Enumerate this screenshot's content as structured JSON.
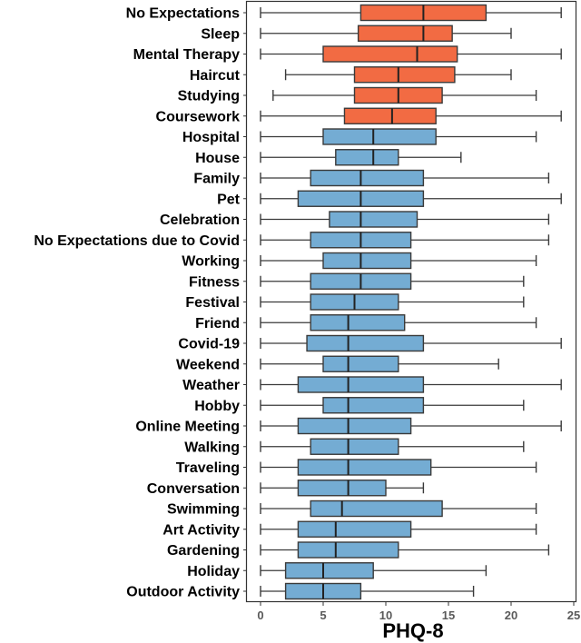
{
  "chart_data": {
    "type": "boxplot",
    "orientation": "horizontal",
    "title": "",
    "xlabel": "PHQ-8",
    "ylabel": "",
    "xlim": [
      0,
      25
    ],
    "xticks": [
      0,
      5,
      10,
      15,
      20,
      25
    ],
    "grid": false,
    "legend": "none",
    "colors": {
      "highlight": "#f26b43",
      "normal": "#74acd3",
      "stroke": "#3a3a3a"
    },
    "categories": [
      {
        "label": "No Expectations",
        "min": 0,
        "q1": 8,
        "median": 13,
        "q3": 18,
        "max": 24,
        "group": "highlight"
      },
      {
        "label": "Sleep",
        "min": 0,
        "q1": 7.8,
        "median": 13,
        "q3": 15.3,
        "max": 20,
        "group": "highlight"
      },
      {
        "label": "Mental Therapy",
        "min": 0,
        "q1": 5,
        "median": 12.5,
        "q3": 15.7,
        "max": 24,
        "group": "highlight"
      },
      {
        "label": "Haircut",
        "min": 2,
        "q1": 7.5,
        "median": 11,
        "q3": 15.5,
        "max": 20,
        "group": "highlight"
      },
      {
        "label": "Studying",
        "min": 1,
        "q1": 7.5,
        "median": 11,
        "q3": 14.5,
        "max": 22,
        "group": "highlight"
      },
      {
        "label": "Coursework",
        "min": 0,
        "q1": 6.7,
        "median": 10.5,
        "q3": 14,
        "max": 24,
        "group": "highlight"
      },
      {
        "label": "Hospital",
        "min": 0,
        "q1": 5,
        "median": 9,
        "q3": 14,
        "max": 22,
        "group": "normal"
      },
      {
        "label": "House",
        "min": 0,
        "q1": 6,
        "median": 9,
        "q3": 11,
        "max": 16,
        "group": "normal"
      },
      {
        "label": "Family",
        "min": 0,
        "q1": 4,
        "median": 8,
        "q3": 13,
        "max": 23,
        "group": "normal"
      },
      {
        "label": "Pet",
        "min": 0,
        "q1": 3,
        "median": 8,
        "q3": 13,
        "max": 24,
        "group": "normal"
      },
      {
        "label": "Celebration",
        "min": 0,
        "q1": 5.5,
        "median": 8,
        "q3": 12.5,
        "max": 23,
        "group": "normal"
      },
      {
        "label": "No Expectations due to Covid",
        "min": 0,
        "q1": 4,
        "median": 8,
        "q3": 12,
        "max": 23,
        "group": "normal"
      },
      {
        "label": "Working",
        "min": 0,
        "q1": 5,
        "median": 8,
        "q3": 12,
        "max": 22,
        "group": "normal"
      },
      {
        "label": "Fitness",
        "min": 0,
        "q1": 4,
        "median": 8,
        "q3": 12,
        "max": 21,
        "group": "normal"
      },
      {
        "label": "Festival",
        "min": 0,
        "q1": 4,
        "median": 7.5,
        "q3": 11,
        "max": 21,
        "group": "normal"
      },
      {
        "label": "Friend",
        "min": 0,
        "q1": 4,
        "median": 7,
        "q3": 11.5,
        "max": 22,
        "group": "normal"
      },
      {
        "label": "Covid-19",
        "min": 0,
        "q1": 3.7,
        "median": 7,
        "q3": 13,
        "max": 24,
        "group": "normal"
      },
      {
        "label": "Weekend",
        "min": 0,
        "q1": 5,
        "median": 7,
        "q3": 11,
        "max": 19,
        "group": "normal"
      },
      {
        "label": "Weather",
        "min": 0,
        "q1": 3,
        "median": 7,
        "q3": 13,
        "max": 24,
        "group": "normal"
      },
      {
        "label": "Hobby",
        "min": 0,
        "q1": 5,
        "median": 7,
        "q3": 13,
        "max": 21,
        "group": "normal"
      },
      {
        "label": "Online Meeting",
        "min": 0,
        "q1": 3,
        "median": 7,
        "q3": 12,
        "max": 24,
        "group": "normal"
      },
      {
        "label": "Walking",
        "min": 0,
        "q1": 4,
        "median": 7,
        "q3": 11,
        "max": 21,
        "group": "normal"
      },
      {
        "label": "Traveling",
        "min": 0,
        "q1": 3,
        "median": 7,
        "q3": 13.6,
        "max": 22,
        "group": "normal"
      },
      {
        "label": "Conversation",
        "min": 0,
        "q1": 3,
        "median": 7,
        "q3": 10,
        "max": 13,
        "group": "normal"
      },
      {
        "label": "Swimming",
        "min": 0,
        "q1": 4,
        "median": 6.5,
        "q3": 14.5,
        "max": 22,
        "group": "normal"
      },
      {
        "label": "Art Activity",
        "min": 0,
        "q1": 3,
        "median": 6,
        "q3": 12,
        "max": 22,
        "group": "normal"
      },
      {
        "label": "Gardening",
        "min": 0,
        "q1": 3,
        "median": 6,
        "q3": 11,
        "max": 23,
        "group": "normal"
      },
      {
        "label": "Holiday",
        "min": 0,
        "q1": 2,
        "median": 5,
        "q3": 9,
        "max": 18,
        "group": "normal"
      },
      {
        "label": "Outdoor Activity",
        "min": 0,
        "q1": 2,
        "median": 5,
        "q3": 8,
        "max": 17,
        "group": "normal"
      }
    ]
  }
}
